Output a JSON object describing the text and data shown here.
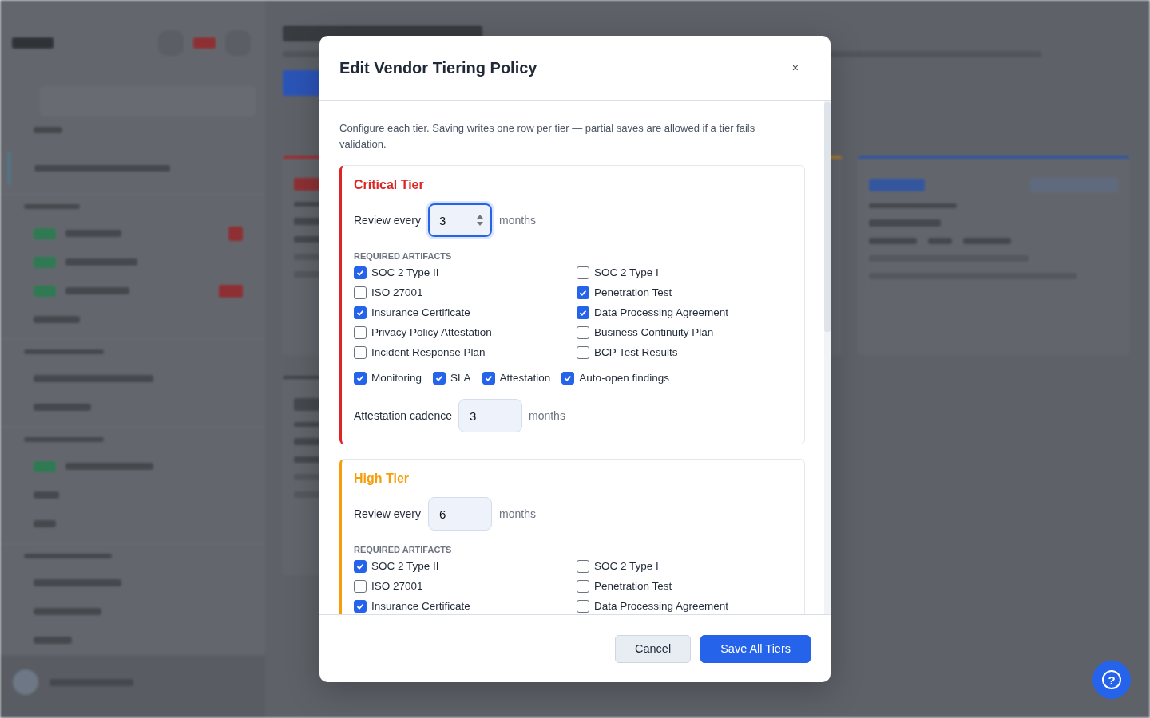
{
  "modal": {
    "title": "Edit Vendor Tiering Policy",
    "close": "×",
    "description": "Configure each tier. Saving writes one row per tier — partial saves are allowed if a tier fails validation.",
    "tiers": [
      {
        "name": "Critical Tier",
        "color": "#dc2626",
        "review_label": "Review every",
        "review_value": "3",
        "review_focused": true,
        "unit": "months",
        "artifacts_heading": "REQUIRED ARTIFACTS",
        "artifacts": [
          {
            "label": "SOC 2 Type II",
            "checked": true
          },
          {
            "label": "SOC 2 Type I",
            "checked": false
          },
          {
            "label": "ISO 27001",
            "checked": false
          },
          {
            "label": "Penetration Test",
            "checked": true
          },
          {
            "label": "Insurance Certificate",
            "checked": true
          },
          {
            "label": "Data Processing Agreement",
            "checked": true
          },
          {
            "label": "Privacy Policy Attestation",
            "checked": false
          },
          {
            "label": "Business Continuity Plan",
            "checked": false
          },
          {
            "label": "Incident Response Plan",
            "checked": false
          },
          {
            "label": "BCP Test Results",
            "checked": false
          }
        ],
        "options": [
          {
            "label": "Monitoring",
            "checked": true
          },
          {
            "label": "SLA",
            "checked": true
          },
          {
            "label": "Attestation",
            "checked": true
          },
          {
            "label": "Auto-open findings",
            "checked": true
          }
        ],
        "cadence_label": "Attestation cadence",
        "cadence_value": "3",
        "cadence_unit": "months"
      },
      {
        "name": "High Tier",
        "color": "#f59e0b",
        "review_label": "Review every",
        "review_value": "6",
        "review_focused": false,
        "unit": "months",
        "artifacts_heading": "REQUIRED ARTIFACTS",
        "artifacts": [
          {
            "label": "SOC 2 Type II",
            "checked": true
          },
          {
            "label": "SOC 2 Type I",
            "checked": false
          },
          {
            "label": "ISO 27001",
            "checked": false
          },
          {
            "label": "Penetration Test",
            "checked": false
          },
          {
            "label": "Insurance Certificate",
            "checked": true
          },
          {
            "label": "Data Processing Agreement",
            "checked": false
          }
        ]
      }
    ],
    "buttons": [
      {
        "label": "Cancel",
        "kind": "secondary"
      },
      {
        "label": "Save All Tiers",
        "kind": "primary"
      }
    ]
  },
  "help_button": {
    "label": "?"
  }
}
